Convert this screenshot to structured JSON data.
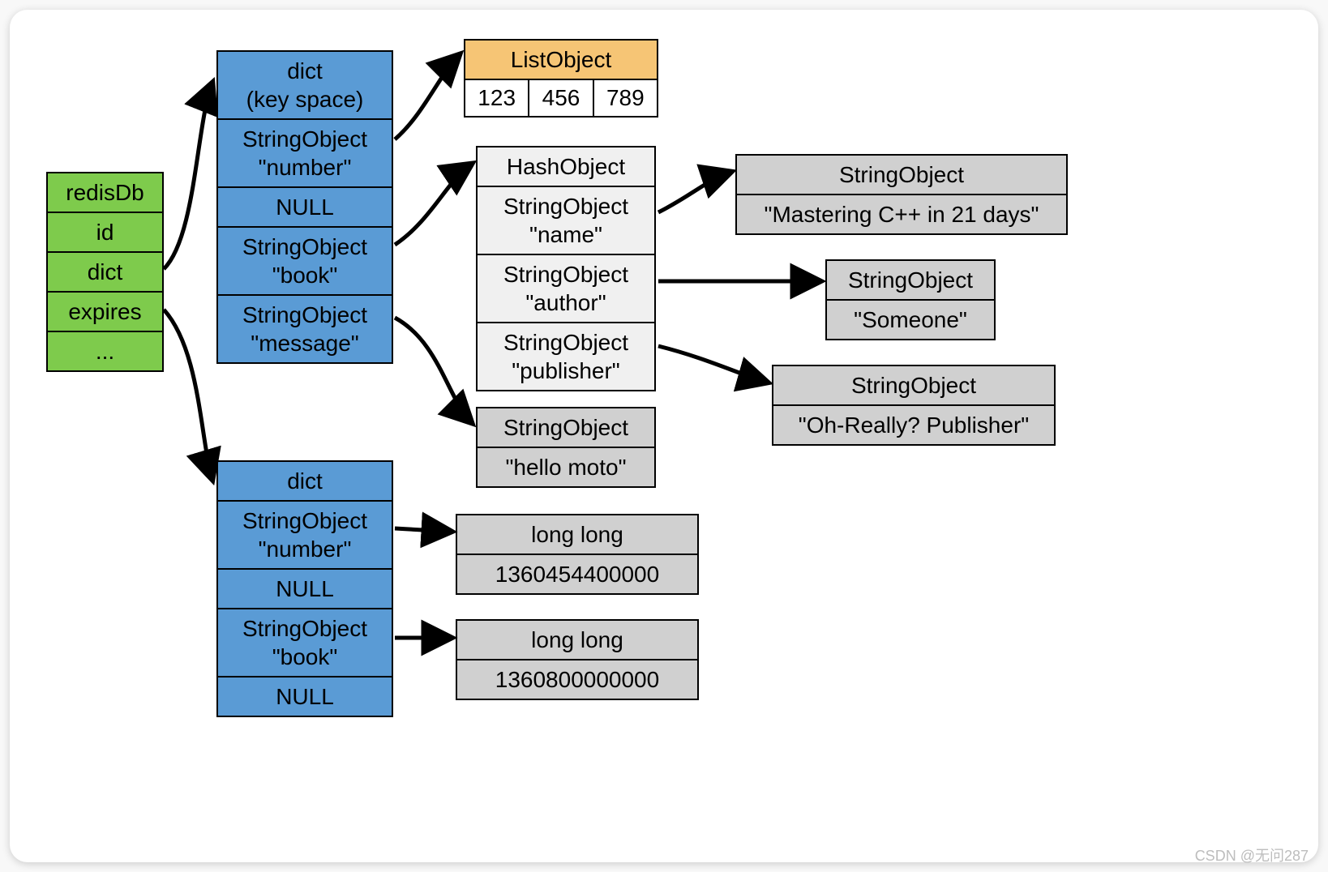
{
  "redisDb": {
    "title": "redisDb",
    "rows": [
      "id",
      "dict",
      "expires",
      "..."
    ]
  },
  "keyspace": {
    "title": "dict\n(key space)",
    "rows": [
      "StringObject\n\"number\"",
      "NULL",
      "StringObject\n\"book\"",
      "StringObject\n\"message\""
    ]
  },
  "expiresDict": {
    "title": "dict",
    "rows": [
      "StringObject\n\"number\"",
      "NULL",
      "StringObject\n\"book\"",
      "NULL"
    ]
  },
  "listObject": {
    "title": "ListObject",
    "items": [
      "123",
      "456",
      "789"
    ]
  },
  "hashObject": {
    "title": "HashObject",
    "rows": [
      "StringObject\n\"name\"",
      "StringObject\n\"author\"",
      "StringObject\n\"publisher\""
    ]
  },
  "helloMoto": {
    "title": "StringObject",
    "value": "\"hello moto\""
  },
  "mastering": {
    "title": "StringObject",
    "value": "\"Mastering C++ in 21 days\""
  },
  "someone": {
    "title": "StringObject",
    "value": "\"Someone\""
  },
  "publisher": {
    "title": "StringObject",
    "value": "\"Oh-Really? Publisher\""
  },
  "longlong1": {
    "title": "long long",
    "value": "1360454400000"
  },
  "longlong2": {
    "title": "long long",
    "value": "1360800000000"
  },
  "watermark": "CSDN @无问287"
}
